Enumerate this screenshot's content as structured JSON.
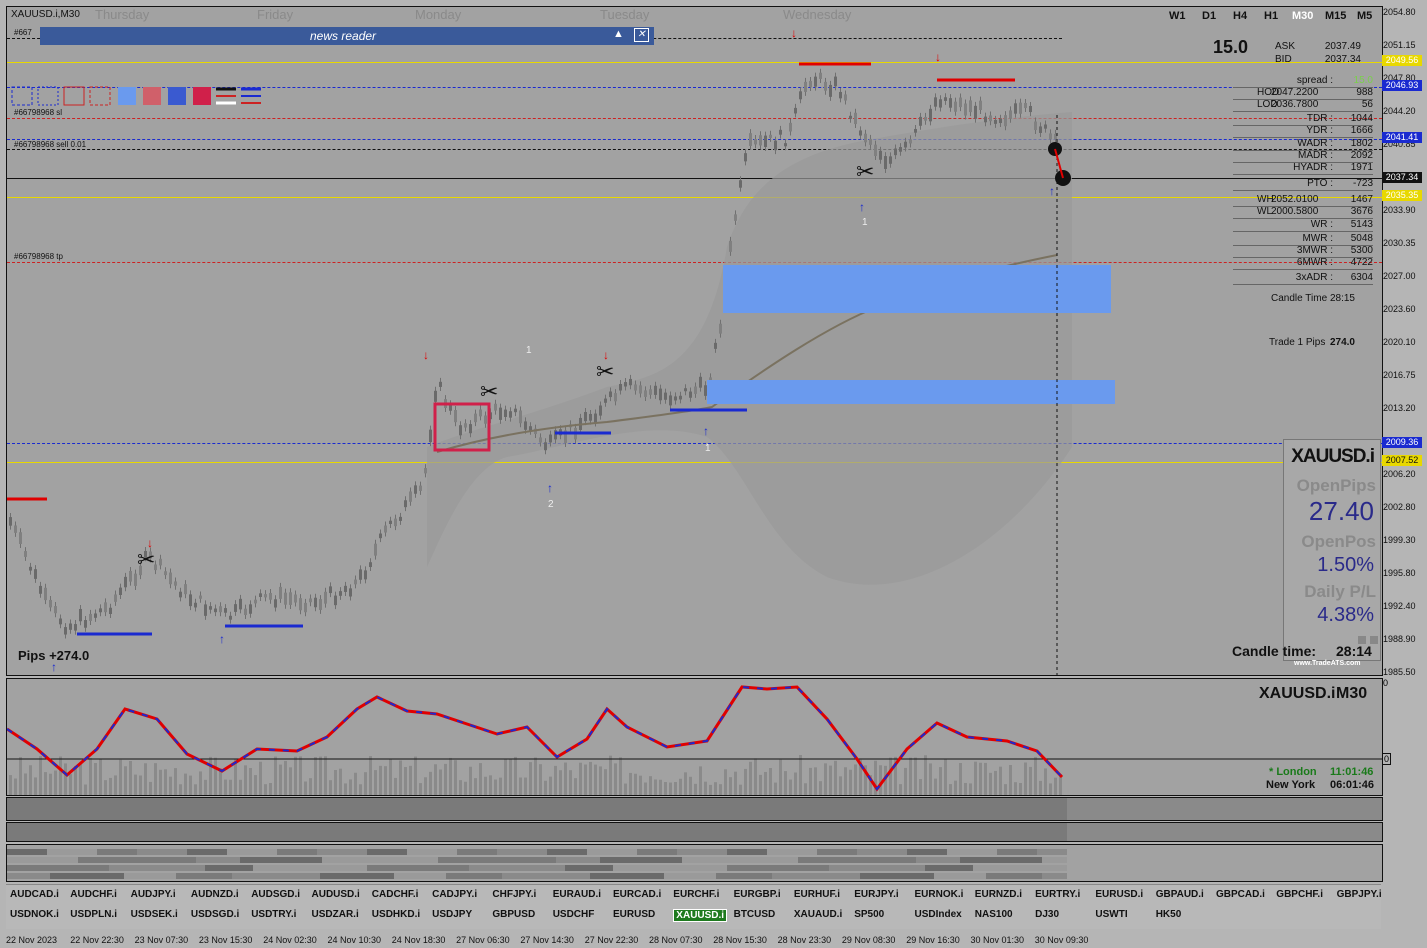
{
  "window": {
    "title": "XAUUSD.i,M30"
  },
  "days": [
    "Thursday",
    "Friday",
    "Monday",
    "Tuesday",
    "Wednesday"
  ],
  "timeframes": [
    "W1",
    "D1",
    "H4",
    "H1",
    "M30",
    "M15",
    "M5"
  ],
  "active_timeframe": "M30",
  "news": {
    "title": "news reader"
  },
  "lines": {
    "sl": "#66798968 sl",
    "sell": "#66798968 sell 0.01",
    "tp": "#66798968 tp",
    "first": "#667"
  },
  "price_axis": [
    "2054.80",
    "2051.15",
    "2047.80",
    "2044.20",
    "2040.85",
    "2037.25",
    "2033.90",
    "2030.35",
    "2027.00",
    "2023.60",
    "2020.10",
    "2016.75",
    "2013.20",
    "2009.80",
    "2006.20",
    "2002.80",
    "1999.30",
    "1995.80",
    "1992.40",
    "1988.90",
    "1985.50"
  ],
  "price_tags": [
    {
      "text": "2049.56",
      "bg": "#e8d800",
      "fg": "#ffffff"
    },
    {
      "text": "2046.93",
      "bg": "#1a2ad0",
      "fg": "#ffffff"
    },
    {
      "text": "2041.41",
      "bg": "#1a2ad0",
      "fg": "#ffffff"
    },
    {
      "text": "2037.34",
      "bg": "#111111",
      "fg": "#ffffff"
    },
    {
      "text": "2035.35",
      "bg": "#e8d800",
      "fg": "#ffffff"
    },
    {
      "text": "2009.36",
      "bg": "#1a2ad0",
      "fg": "#ffffff"
    },
    {
      "text": "2007.52",
      "bg": "#e8d800",
      "fg": "#111111"
    }
  ],
  "info": {
    "spread_big": "15.0",
    "rows": [
      {
        "label": "ASK",
        "value": "2037.49"
      },
      {
        "label": "BID",
        "value": "2037.34"
      },
      {
        "label": "spread :",
        "value": "15.0"
      },
      {
        "label": "HOD",
        "value": "2047.2200",
        "extra": "988"
      },
      {
        "label": "LOD",
        "value": "2036.7800",
        "extra": "56"
      },
      {
        "label": "TDR :",
        "value": "1044"
      },
      {
        "label": "YDR :",
        "value": "1666"
      },
      {
        "label": "WADR :",
        "value": "1802"
      },
      {
        "label": "MADR :",
        "value": "2092"
      },
      {
        "label": "HYADR :",
        "value": "1971"
      },
      {
        "label": "PTO :",
        "value": "-723"
      },
      {
        "label": "WH",
        "value": "2052.0100",
        "extra": "1467"
      },
      {
        "label": "WL",
        "value": "2000.5800",
        "extra": "3676"
      },
      {
        "label": "WR :",
        "value": "5143"
      },
      {
        "label": "MWR :",
        "value": "5048"
      },
      {
        "label": "3MWR :",
        "value": "5300"
      },
      {
        "label": "6MWR :",
        "value": "4722"
      },
      {
        "label": "3xADR :",
        "value": "6304"
      },
      {
        "label": "Candle Time",
        "value": "28:15"
      },
      {
        "label": "Trade 1 Pips",
        "value": "274.0"
      }
    ]
  },
  "panel": {
    "symbol": "XAUUSD.i",
    "open_pips_label": "OpenPips",
    "open_pips": "27.40",
    "open_pos_label": "OpenPos",
    "open_pos": "1.50%",
    "daily_label": "Daily P/L",
    "daily": "4.38%",
    "candle_label": "Candle time:",
    "candle_value": "28:14",
    "site": "www.TradeATS.com"
  },
  "pips_label": "Pips +274.0",
  "markers": [
    "1",
    "1",
    "2",
    "1",
    "1"
  ],
  "sub": {
    "symbol": "XAUUSD.i",
    "tf": "M30",
    "london_label": "* London",
    "london_time": "11:01:46",
    "ny_label": "New York",
    "ny_time": "06:01:46",
    "axis_top": "0",
    "axis_mid": "0"
  },
  "symbols_row1": [
    "AUDCAD.i",
    "AUDCHF.i",
    "AUDJPY.i",
    "AUDNZD.i",
    "AUDSGD.i",
    "AUDUSD.i",
    "CADCHF.i",
    "CADJPY.i",
    "CHFJPY.i",
    "EURAUD.i",
    "EURCAD.i",
    "EURCHF.i",
    "EURGBP.i",
    "EURHUF.i",
    "EURJPY.i",
    "EURNOK.i",
    "EURNZD.i",
    "EURTRY.i",
    "EURUSD.i",
    "GBPAUD.i",
    "GBPCAD.i",
    "GBPCHF.i",
    "GBPJPY.i"
  ],
  "symbols_row2": [
    "USDNOK.i",
    "USDPLN.i",
    "USDSEK.i",
    "USDSGD.i",
    "USDTRY.i",
    "USDZAR.i",
    "USDHKD.i",
    "USDJPY",
    "GBPUSD",
    "USDCHF",
    "EURUSD",
    "XAUUSD.i",
    "BTCUSD",
    "XAUAUD.i",
    "SP500",
    "USDIndex",
    "NAS100",
    "DJ30",
    "USWTI",
    "HK50"
  ],
  "active_symbol": "XAUUSD.i",
  "time_axis": [
    "22 Nov 2023",
    "22 Nov 22:30",
    "23 Nov 07:30",
    "23 Nov 15:30",
    "24 Nov 02:30",
    "24 Nov 10:30",
    "24 Nov 18:30",
    "27 Nov 06:30",
    "27 Nov 14:30",
    "27 Nov 22:30",
    "28 Nov 07:30",
    "28 Nov 15:30",
    "28 Nov 23:30",
    "29 Nov 08:30",
    "29 Nov 16:30",
    "30 Nov 01:30",
    "30 Nov 09:30"
  ],
  "colors": {
    "ask_line": "#e8d800",
    "bid_line": "#1a2ad0",
    "tp_line": "#cc2222",
    "zone": "#6a9aee",
    "wma": "#8a7a50",
    "osc_up": "#1a2ad0",
    "osc_down": "#e00000"
  }
}
